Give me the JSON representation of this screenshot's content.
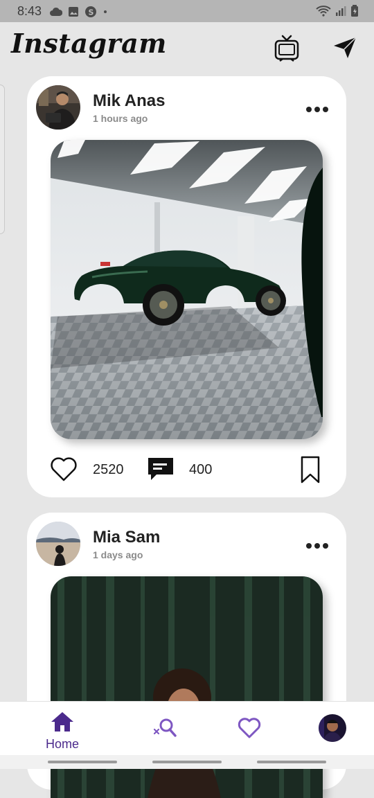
{
  "status_bar": {
    "time": "8:43"
  },
  "app": {
    "title": "Instagram"
  },
  "posts": [
    {
      "username": "Mik Anas",
      "time_ago": "1 hours ago",
      "likes": "2520",
      "comments": "400"
    },
    {
      "username": "Mia Sam",
      "time_ago": "1 days ago"
    }
  ],
  "nav": {
    "home_label": "Home"
  },
  "colors": {
    "accent": "#4b2a8c",
    "icon_purple": "#7e57c2",
    "background": "#e6e6e6"
  }
}
